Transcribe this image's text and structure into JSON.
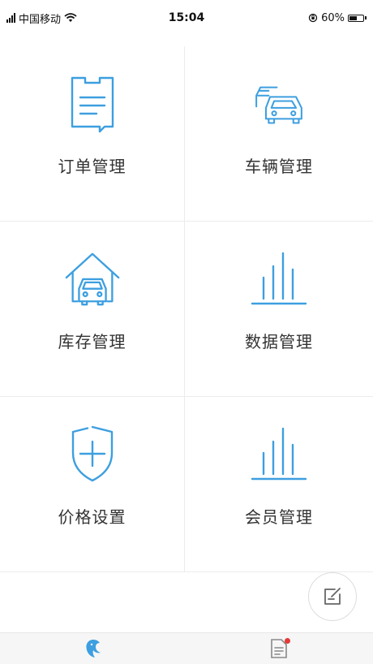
{
  "status_bar": {
    "carrier": "中国移动",
    "time": "15:04",
    "battery": "60%",
    "battery_level": 0.6
  },
  "colors": {
    "accent": "#3d9fe0",
    "text": "#333333",
    "divider": "#ececec",
    "badge": "#e53935"
  },
  "menu": {
    "items": [
      {
        "label": "订单管理",
        "icon": "order-icon"
      },
      {
        "label": "车辆管理",
        "icon": "cars-icon"
      },
      {
        "label": "库存管理",
        "icon": "garage-icon"
      },
      {
        "label": "数据管理",
        "icon": "bar-chart-icon"
      },
      {
        "label": "价格设置",
        "icon": "shield-plus-icon"
      },
      {
        "label": "会员管理",
        "icon": "bar-chart-icon"
      }
    ]
  },
  "fab": {
    "icon": "edit-icon"
  },
  "tab_bar": {
    "tabs": [
      {
        "icon": "dolphin-icon",
        "active": true
      },
      {
        "icon": "document-icon",
        "badge": true
      }
    ]
  }
}
